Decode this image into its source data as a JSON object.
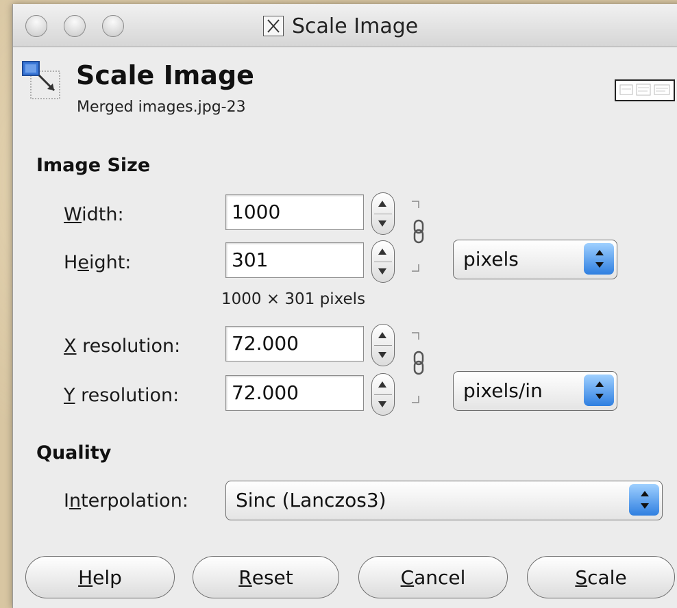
{
  "window": {
    "title": "Scale Image"
  },
  "header": {
    "title": "Scale Image",
    "subtitle": "Merged images.jpg-23"
  },
  "image_size": {
    "section_title": "Image Size",
    "width": {
      "label_u": "W",
      "label_rest": "idth:",
      "value": "1000"
    },
    "height": {
      "label_pre": "H",
      "label_u": "e",
      "label_rest": "ight:",
      "value": "301"
    },
    "size_note": "1000 × 301 pixels",
    "size_unit": "pixels",
    "x_res": {
      "label_u": "X",
      "label_rest": " resolution:",
      "value": "72.000"
    },
    "y_res": {
      "label_u": "Y",
      "label_rest": " resolution:",
      "value": "72.000"
    },
    "res_unit": "pixels/in"
  },
  "quality": {
    "section_title": "Quality",
    "interpolation": {
      "label_pre": "I",
      "label_u": "n",
      "label_rest": "terpolation:",
      "value": "Sinc (Lanczos3)"
    }
  },
  "buttons": {
    "help": {
      "u": "H",
      "rest": "elp"
    },
    "reset": {
      "u": "R",
      "rest": "eset"
    },
    "cancel": {
      "u": "C",
      "rest": "ancel"
    },
    "scale": {
      "u": "S",
      "rest": "cale"
    }
  },
  "colors": {
    "accent": "#2f7fe0",
    "dialog_bg": "#ececec",
    "desktop_bg": "#d8c6a2"
  },
  "icons": [
    "window-close-icon",
    "window-minimize-icon",
    "window-zoom-icon",
    "x11-app-icon",
    "scale-image-icon",
    "chain-link-icon",
    "spin-up-icon",
    "spin-down-icon",
    "select-arrows-icon",
    "image-preview-thumbnail"
  ]
}
